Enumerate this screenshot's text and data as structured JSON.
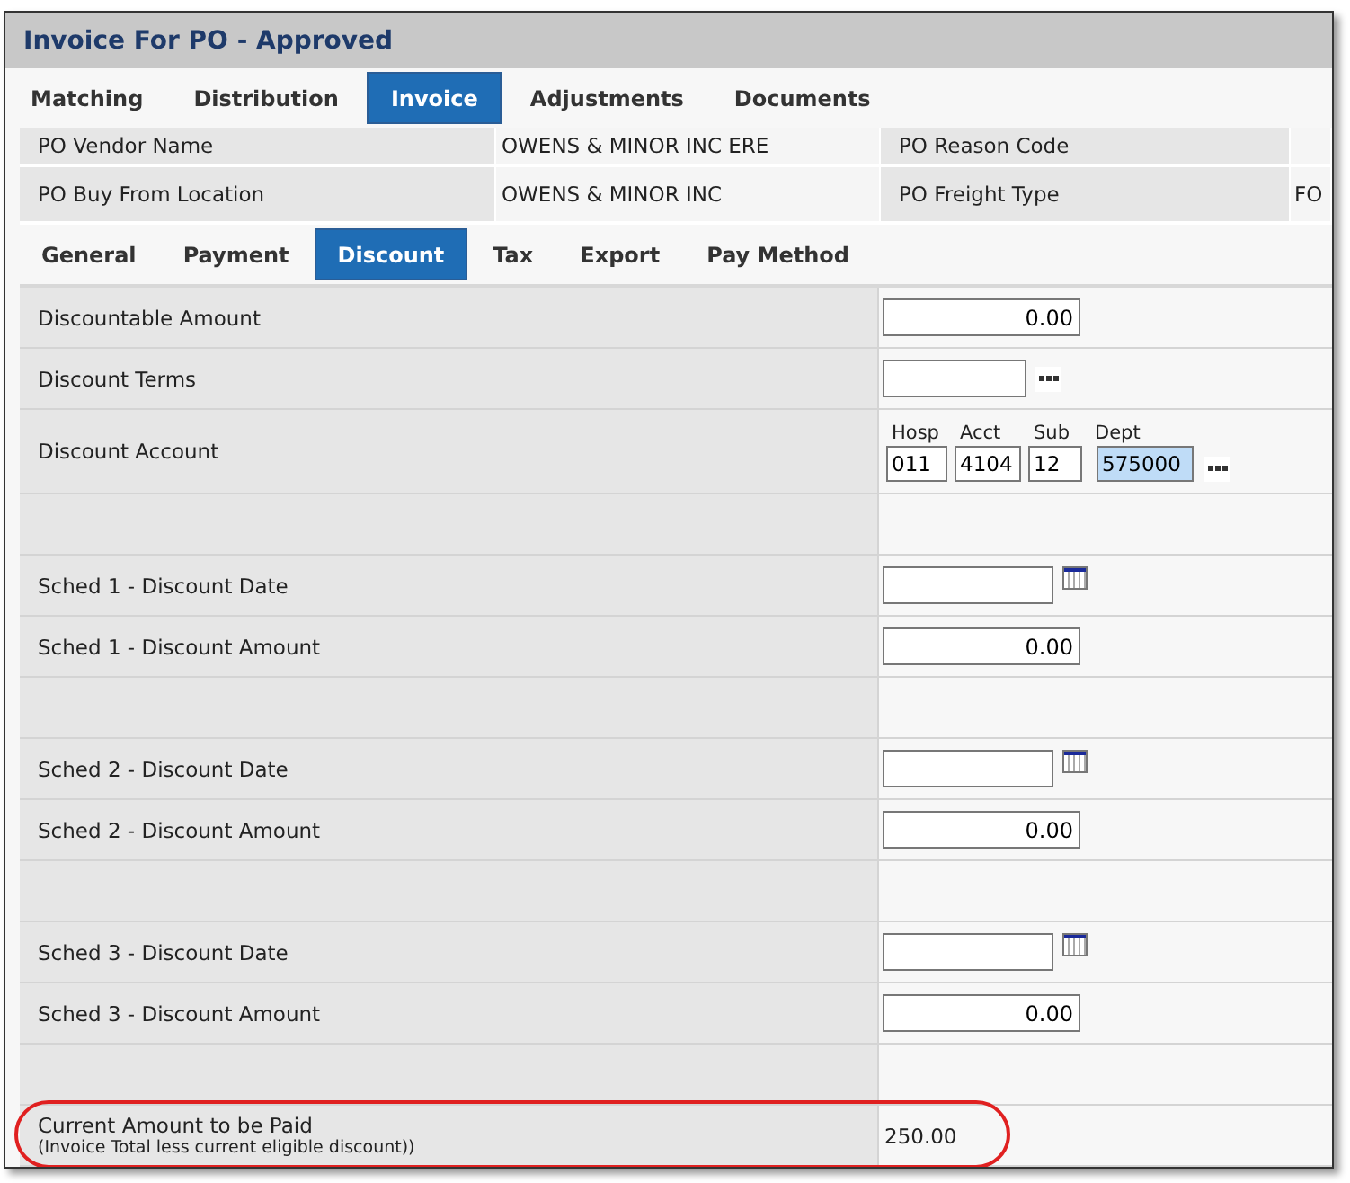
{
  "window": {
    "title": "Invoice For PO - Approved"
  },
  "tabs": [
    {
      "label": "Matching",
      "selected": false
    },
    {
      "label": "Distribution",
      "selected": false
    },
    {
      "label": "Invoice",
      "selected": true
    },
    {
      "label": "Adjustments",
      "selected": false
    },
    {
      "label": "Documents",
      "selected": false
    }
  ],
  "po_info": [
    {
      "label": "PO Vendor Name",
      "value": "OWENS & MINOR INC ERE",
      "label_2": "PO Reason Code"
    },
    {
      "label": "PO Buy From Location",
      "value": "OWENS & MINOR INC",
      "label_2": "PO Freight Type",
      "column_4": "FO"
    }
  ],
  "subtabs": [
    {
      "label": "General",
      "selected": false
    },
    {
      "label": "Payment",
      "selected": false
    },
    {
      "label": "Discount",
      "selected": true
    },
    {
      "label": "Tax",
      "selected": false
    },
    {
      "label": "Export",
      "selected": false
    },
    {
      "label": "Pay Method",
      "selected": false
    }
  ],
  "rows": [
    {
      "kind": "amount",
      "label": "Discountable Amount",
      "value": "0.00"
    },
    {
      "kind": "lookup",
      "label": "Discount Terms"
    },
    {
      "kind": "account",
      "label": "Discount Account",
      "segments": [
        {
          "label": "Hosp",
          "value": "011",
          "selected": false
        },
        {
          "label": "Acct",
          "value": "4104",
          "selected": false
        },
        {
          "label": "Sub",
          "value": "12",
          "selected": false
        },
        {
          "label": "Dept",
          "value": "575000",
          "selected": true
        }
      ]
    },
    {
      "kind": "spacer"
    },
    {
      "kind": "date",
      "label": "Sched 1 - Discount Date"
    },
    {
      "kind": "amount",
      "label": "Sched 1 - Discount Amount",
      "value": "0.00"
    },
    {
      "kind": "spacer"
    },
    {
      "kind": "date",
      "label": "Sched 2 - Discount Date"
    },
    {
      "kind": "amount",
      "label": "Sched 2 - Discount Amount",
      "value": "0.00"
    },
    {
      "kind": "spacer"
    },
    {
      "kind": "date",
      "label": "Sched 3 - Discount Date"
    },
    {
      "kind": "amount",
      "label": "Sched 3 - Discount Amount",
      "value": "0.00"
    },
    {
      "kind": "spacer"
    },
    {
      "kind": "total",
      "label": "Current Amount to be Paid",
      "note": "(Invoice Total less current eligible discount))",
      "value": "250.00",
      "highlighted": true
    }
  ]
}
